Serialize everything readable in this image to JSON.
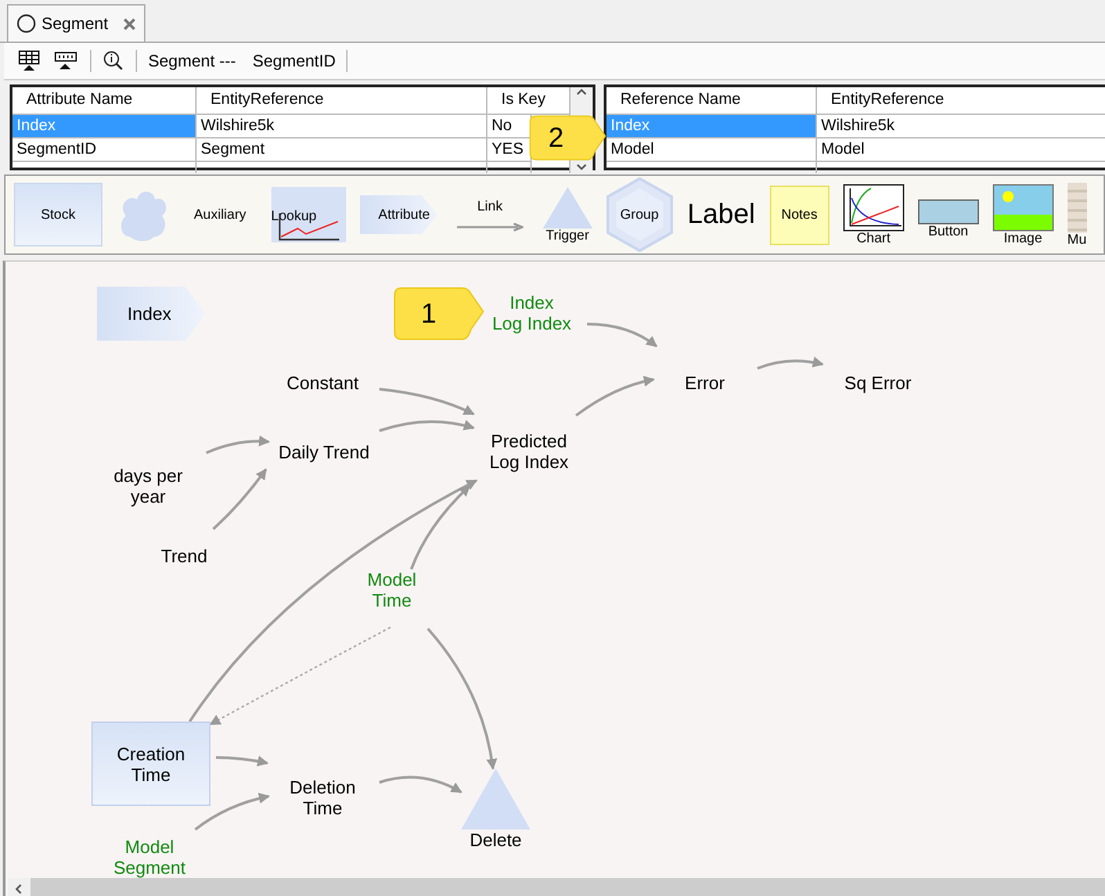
{
  "tab": {
    "title": "Segment"
  },
  "toolbar": {
    "entity": "Segment ---",
    "key": "SegmentID"
  },
  "attributes_table": {
    "columns": [
      "Attribute Name",
      "EntityReference",
      "Is Key"
    ],
    "rows": [
      {
        "cells": [
          "Index",
          "Wilshire5k",
          "No"
        ],
        "selected": true
      },
      {
        "cells": [
          "SegmentID",
          "Segment",
          "YES"
        ],
        "selected": false
      }
    ]
  },
  "references_table": {
    "columns": [
      "Reference Name",
      "EntityReference"
    ],
    "rows": [
      {
        "cells": [
          "Index",
          "Wilshire5k"
        ],
        "selected": true
      },
      {
        "cells": [
          "Model",
          "Model"
        ],
        "selected": false
      }
    ]
  },
  "palette": [
    {
      "kind": "stock",
      "label": "Stock"
    },
    {
      "kind": "cloud"
    },
    {
      "kind": "text",
      "label": "Auxiliary"
    },
    {
      "kind": "lookup",
      "label": "Lookup"
    },
    {
      "kind": "attribute",
      "label": "Attribute"
    },
    {
      "kind": "link",
      "label": "Link"
    },
    {
      "kind": "trigger",
      "label": "Trigger"
    },
    {
      "kind": "group",
      "label": "Group"
    },
    {
      "kind": "label",
      "label": "Label"
    },
    {
      "kind": "notes",
      "label": "Notes"
    },
    {
      "kind": "chart",
      "label": "Chart"
    },
    {
      "kind": "button",
      "label": "Button"
    },
    {
      "kind": "image",
      "label": "Image"
    },
    {
      "kind": "more",
      "label": "Mu"
    }
  ],
  "diagram": {
    "nodes": [
      {
        "kind": "attribute",
        "label": "Index"
      },
      {
        "kind": "reference",
        "label": "Index\nLog Index"
      },
      {
        "kind": "variable",
        "label": "Constant"
      },
      {
        "kind": "variable",
        "label": "Daily Trend"
      },
      {
        "kind": "variable",
        "label": "days per\nyear"
      },
      {
        "kind": "variable",
        "label": "Trend"
      },
      {
        "kind": "variable",
        "label": "Predicted\nLog Index"
      },
      {
        "kind": "variable",
        "label": "Error"
      },
      {
        "kind": "variable",
        "label": "Sq Error"
      },
      {
        "kind": "reference",
        "label": "Model\nTime"
      },
      {
        "kind": "stock",
        "label": "Creation\nTime"
      },
      {
        "kind": "variable",
        "label": "Deletion\nTime"
      },
      {
        "kind": "trigger",
        "label": "Delete"
      },
      {
        "kind": "reference",
        "label": "Model\nSegment"
      }
    ],
    "callouts": [
      {
        "number": "1"
      },
      {
        "number": "2"
      }
    ]
  }
}
